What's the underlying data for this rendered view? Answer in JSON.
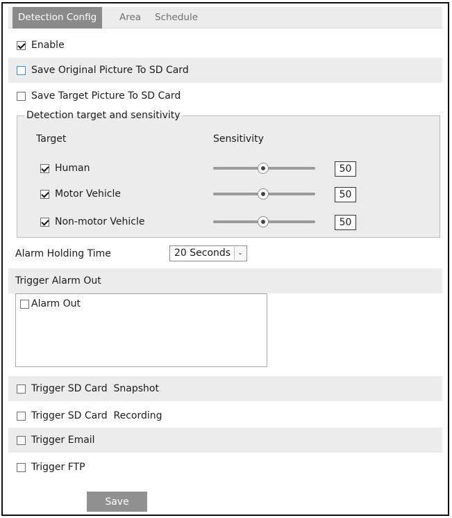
{
  "tabs": [
    {
      "label": "Detection Config",
      "active": true
    },
    {
      "label": "Area",
      "active": false
    },
    {
      "label": "Schedule",
      "active": false
    }
  ],
  "options": {
    "enable": {
      "label": "Enable",
      "checked": true
    },
    "save_original": {
      "label": "Save Original Picture To SD Card",
      "checked": false
    },
    "save_target": {
      "label": "Save Target Picture To SD Card",
      "checked": false
    }
  },
  "detection": {
    "legend": "Detection target and sensitivity",
    "target_header": "Target",
    "sensitivity_header": "Sensitivity",
    "targets": [
      {
        "label": "Human",
        "checked": true,
        "sensitivity": "50"
      },
      {
        "label": "Motor Vehicle",
        "checked": true,
        "sensitivity": "50"
      },
      {
        "label": "Non-motor Vehicle",
        "checked": true,
        "sensitivity": "50"
      }
    ]
  },
  "alarm_holding": {
    "label": "Alarm Holding Time",
    "value": "20 Seconds"
  },
  "trigger_alarm_out": {
    "label": "Trigger Alarm Out",
    "items": [
      {
        "label": "Alarm Out",
        "checked": false
      }
    ]
  },
  "triggers": {
    "sd_snapshot": {
      "label": "Trigger SD Card  Snapshot",
      "checked": false
    },
    "sd_recording": {
      "label": "Trigger SD Card  Recording",
      "checked": false
    },
    "email": {
      "label": "Trigger Email",
      "checked": false
    },
    "ftp": {
      "label": "Trigger FTP",
      "checked": false
    }
  },
  "save_label": "Save",
  "colors": {
    "tab_active": "#8a8a8a",
    "shaded_row": "#ececec",
    "save_button": "#909090",
    "checkbox_focus": "#3a8fd6"
  }
}
